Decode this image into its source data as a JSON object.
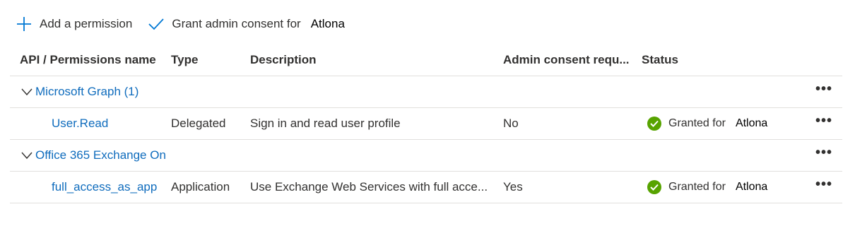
{
  "toolbar": {
    "add_permission_label": "Add a permission",
    "grant_consent_label": "Grant admin consent for",
    "tenant_name": "Atlona"
  },
  "columns": {
    "name": "API / Permissions name",
    "type": "Type",
    "description": "Description",
    "admin_consent": "Admin consent requ...",
    "status": "Status"
  },
  "groups": [
    {
      "label": "Microsoft Graph (1)",
      "permissions": [
        {
          "name": "User.Read",
          "type": "Delegated",
          "description": "Sign in and read user profile",
          "admin_consent": "No",
          "status_text": "Granted for",
          "status_tenant": "Atlona"
        }
      ]
    },
    {
      "label": "Office 365 Exchange On",
      "permissions": [
        {
          "name": "full_access_as_app",
          "type": "Application",
          "description": "Use Exchange Web Services with full acce...",
          "admin_consent": "Yes",
          "status_text": "Granted for",
          "status_tenant": "Atlona"
        }
      ]
    }
  ],
  "more_glyph": "•••",
  "colors": {
    "link": "#0f6cbd",
    "accent": "#0078d4",
    "granted": "#57a300",
    "border": "#e1dfdd"
  }
}
